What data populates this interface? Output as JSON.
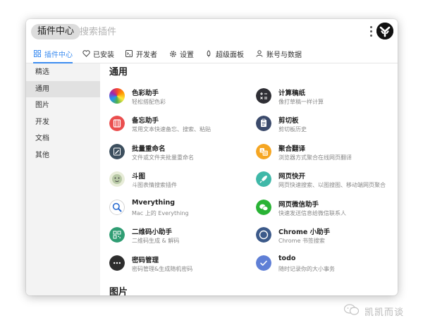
{
  "header": {
    "plugin_center_label": "插件中心",
    "search_placeholder": "搜索插件"
  },
  "tabs": [
    {
      "label": "插件中心",
      "icon": "grid-icon",
      "active": true
    },
    {
      "label": "已安装",
      "icon": "heart-icon"
    },
    {
      "label": "开发者",
      "icon": "terminal-icon"
    },
    {
      "label": "设置",
      "icon": "gear-icon"
    },
    {
      "label": "超级面板",
      "icon": "rocket-icon"
    },
    {
      "label": "账号与数据",
      "icon": "user-icon"
    }
  ],
  "sidebar": {
    "items": [
      {
        "label": "精选"
      },
      {
        "label": "通用",
        "active": true
      },
      {
        "label": "图片"
      },
      {
        "label": "开发"
      },
      {
        "label": "文档"
      },
      {
        "label": "其他"
      }
    ]
  },
  "sections": [
    {
      "title": "通用"
    },
    {
      "title": "图片"
    }
  ],
  "plugins": [
    {
      "title": "色彩助手",
      "desc": "轻松搭配色彩",
      "icon": "color-wheel-icon"
    },
    {
      "title": "计算稿纸",
      "desc": "像打草稿一样计算",
      "icon": "calculator-icon"
    },
    {
      "title": "备忘助手",
      "desc": "常用文本快速备忘、搜索、粘贴",
      "icon": "memo-icon"
    },
    {
      "title": "剪切板",
      "desc": "剪切板历史",
      "icon": "clipboard-icon"
    },
    {
      "title": "批量重命名",
      "desc": "文件或文件夹批量重命名",
      "icon": "rename-icon"
    },
    {
      "title": "聚合翻译",
      "desc": "浏览器方式聚合在线网页翻译",
      "icon": "translate-icon"
    },
    {
      "title": "斗图",
      "desc": "斗图表情搜索插件",
      "icon": "meme-icon"
    },
    {
      "title": "网页快开",
      "desc": "网页快速搜索、以图搜图、移动端网页聚合",
      "icon": "rocket-launch-icon"
    },
    {
      "title": "Mverything",
      "desc": "Mac 上的 Everything",
      "icon": "magnifier-icon"
    },
    {
      "title": "网页微信助手",
      "desc": "快速发送信息给微信联系人",
      "icon": "wechat-icon"
    },
    {
      "title": "二维码小助手",
      "desc": "二维码生成 & 解码",
      "icon": "qrcode-icon"
    },
    {
      "title": "Chrome 小助手",
      "desc": "Chrome 书签搜索",
      "icon": "chrome-ring-icon"
    },
    {
      "title": "密码管理",
      "desc": "密码管理&生成随机密码",
      "icon": "password-icon"
    },
    {
      "title": "todo",
      "desc": "随时记录你的大小事务",
      "icon": "check-icon"
    }
  ],
  "watermark": {
    "text": "凯凯而谈"
  },
  "colors": {
    "accent": "#3d8df0",
    "sidebar_bg": "#f3f3f3",
    "sidebar_active": "#e1e1e1"
  }
}
